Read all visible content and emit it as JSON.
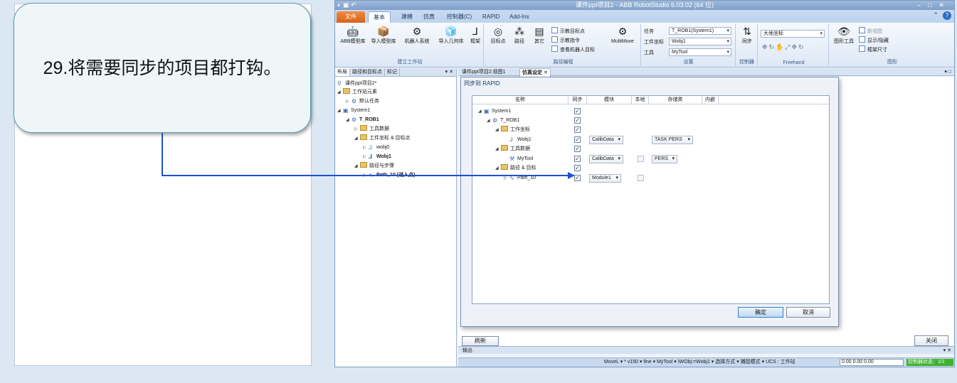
{
  "callout": {
    "number": "29",
    "text": ".将需要同步的项目都打钩。"
  },
  "app": {
    "title": "课件ppt项目2 - ABB RobotStudio 6.03.02 (64 位)",
    "tabs": [
      "文件 (F)",
      "基本",
      "建模",
      "仿真",
      "控制器(C)",
      "RAPID",
      "Add-Ins"
    ],
    "ribbon": {
      "build_station": {
        "label": "建立工作站",
        "buttons": [
          "ABB模型库",
          "导入模型库",
          "机器人系统",
          "导入几何体",
          "框架"
        ]
      },
      "path_programming": {
        "label": "路径编程",
        "buttons": [
          "目标点",
          "路径",
          "其它"
        ],
        "small_buttons": [
          "示教目标点",
          "示教指令",
          "查看机器人目标"
        ],
        "multimove": "MultiMove"
      },
      "settings": {
        "label": "设置",
        "fields": [
          {
            "label": "任务",
            "value": "T_ROB1(System1)"
          },
          {
            "label": "工件坐标",
            "value": "Wobj1"
          },
          {
            "label": "工具",
            "value": "MyTool"
          }
        ]
      },
      "controller": {
        "label": "控制器",
        "button": "同步"
      },
      "freehand": {
        "label": "Freehand",
        "coord": "大地坐标"
      },
      "graphics": {
        "label": "图形",
        "view_tools": "图形工具",
        "items": [
          "新视图",
          "显示/隐藏",
          "框架尺寸"
        ]
      }
    }
  },
  "left_panel": {
    "tabs": [
      "布局",
      "路径和目标点",
      "标记"
    ],
    "tree": [
      {
        "label": "课件ppt项目2*",
        "level": 0
      },
      {
        "label": "工作站元素",
        "level": 1
      },
      {
        "label": "默认任务",
        "level": 2
      },
      {
        "label": "System1",
        "level": 1
      },
      {
        "label": "T_ROB1",
        "level": 2
      },
      {
        "label": "工具数据",
        "level": 3
      },
      {
        "label": "工件坐标 & 目标点",
        "level": 3
      },
      {
        "label": "wobj0",
        "level": 4
      },
      {
        "label": "Wobj1",
        "level": 4
      },
      {
        "label": "路径与步骤",
        "level": 3
      },
      {
        "label": "Path_10 (进入点)",
        "level": 4
      }
    ]
  },
  "main": {
    "doc_tabs": [
      "课件ppt项目2:视图1",
      "仿真设定"
    ],
    "refresh": "刷新",
    "close": "关闭",
    "output": "输出"
  },
  "dialog": {
    "title": "同步到 RAPID",
    "columns": [
      "名称",
      "同步",
      "模块",
      "本地",
      "存储类",
      "内嵌"
    ],
    "rows": [
      {
        "name": "System1",
        "level": 0,
        "sync": true,
        "module": "",
        "local": null,
        "storage": ""
      },
      {
        "name": "T_ROB1",
        "level": 1,
        "sync": true,
        "module": "",
        "local": null,
        "storage": ""
      },
      {
        "name": "工作坐标",
        "level": 2,
        "sync": true,
        "module": "",
        "local": null,
        "storage": ""
      },
      {
        "name": "Wobj1",
        "level": 3,
        "sync": true,
        "module": "CalibData",
        "local": null,
        "storage": "TASK PERS"
      },
      {
        "name": "工具数据",
        "level": 2,
        "sync": true,
        "module": "",
        "local": null,
        "storage": ""
      },
      {
        "name": "MyTool",
        "level": 3,
        "sync": true,
        "module": "CalibData",
        "local": false,
        "storage": "PERS"
      },
      {
        "name": "路径 & 目标",
        "level": 2,
        "sync": true,
        "module": "",
        "local": null,
        "storage": ""
      },
      {
        "name": "Path_10",
        "level": 3,
        "sync": true,
        "module": "Module1",
        "local": false,
        "storage": ""
      }
    ],
    "ok": "确定",
    "cancel": "取消"
  },
  "status": {
    "text": "MoveL ▾ * v150 ▾ fine ▾ MyTool ▾ \\WObj:=Wobj1 ▾    选择方式 ▾ 捕捉模式 ▾   UCS : 工作站",
    "coords": "0.00  0.00  0.00",
    "controller_state": "控制器状态：1/1"
  },
  "colors": {
    "accent_blue": "#2a6dc4",
    "file_tab": "#e0742b",
    "ok_green": "#3fb22d"
  }
}
